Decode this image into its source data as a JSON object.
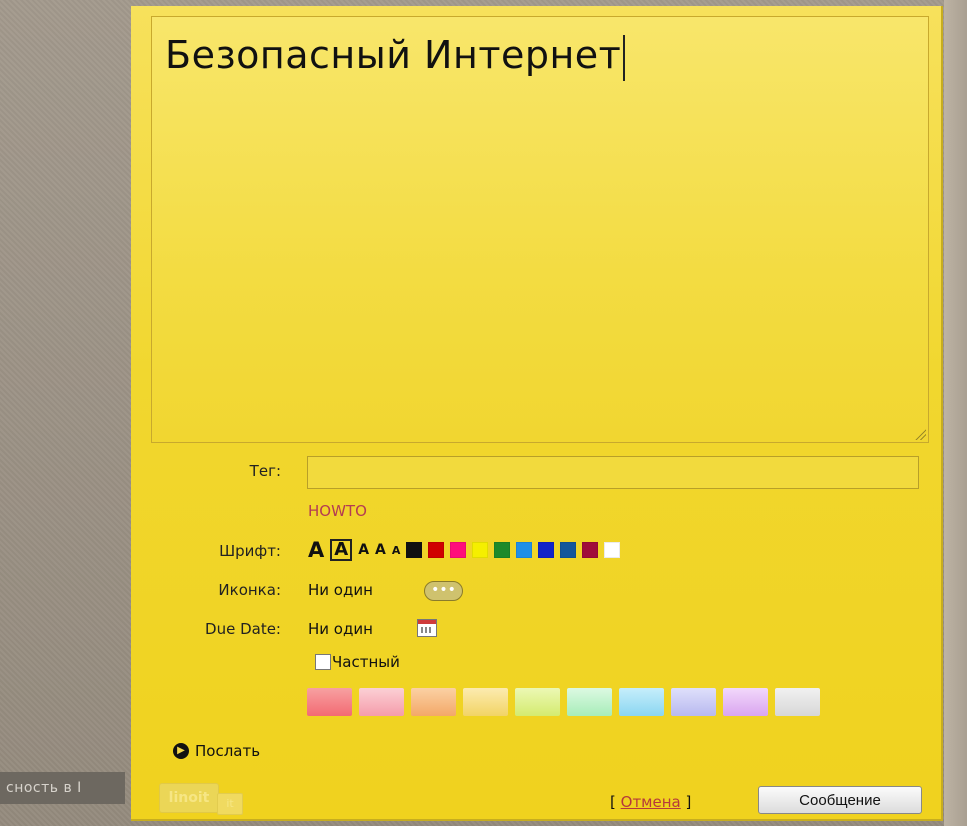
{
  "background": {
    "bottom_left_text": "сность в I"
  },
  "note": {
    "title_text": "Безопасный Интернет"
  },
  "form": {
    "tag_label": "Тег:",
    "tag_value": "",
    "tag_suggestion": "HOWTO",
    "font_label": "Шрифт:",
    "font_letters": [
      "A",
      "A",
      "A",
      "A",
      "A"
    ],
    "icon_label": "Иконка:",
    "icon_value": "Ни один",
    "due_label": "Due Date:",
    "due_value": "Ни один",
    "private_label": "Частный",
    "send_label": "Послать",
    "cancel_left": "[",
    "cancel_link": "Отмена",
    "cancel_right": "]",
    "submit_label": "Сообщение"
  },
  "colors": {
    "text_palette": [
      "#111111",
      "#d00000",
      "#ff0f7b",
      "#f5ef00",
      "#1d8a2a",
      "#1f8fe8",
      "#1224c9",
      "#14579b",
      "#a00d3a",
      "#ffffff"
    ],
    "note_palette": [
      "#f4737b",
      "#f7a8b5",
      "#f6b16f",
      "#f5d96f",
      "#d7ef6e",
      "#a8f0b5",
      "#89d8f0",
      "#b7b8ef",
      "#d9a4ef",
      "#dbdbdb"
    ]
  },
  "branding": {
    "logo_main": "linoit",
    "logo_side": "it"
  }
}
